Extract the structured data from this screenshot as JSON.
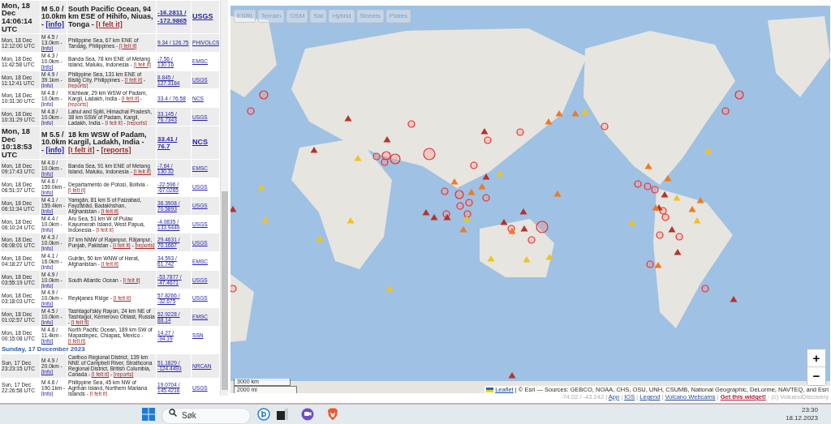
{
  "quake_list": {
    "link_separator": "-",
    "rows": [
      {
        "kind": "major",
        "time": "Mon, 18 Dec 14:06:14 UTC",
        "magnitude": "M 5.0 / 10.0km -",
        "info": "[info]",
        "location": "South Pacific Ocean, 94 km ESE of Hihifo, Niuas, Tonga -",
        "felt": "[I felt it]",
        "coords": "-16.2811 / -172.9865",
        "source": "USGS"
      },
      {
        "kind": "minor",
        "time": "Mon, 18 Dec 12:12:00 UTC",
        "magnitude": "M 4.5 / 13.0km -",
        "info": "[info]",
        "location": "Philippine Sea, 67 km ENE of Tandag, Philippines -",
        "felt": "[I felt it]",
        "coords": "9.34 / 126.75",
        "source": "PHIVOLCS"
      },
      {
        "kind": "minor",
        "time": "Mon, 18 Dec 11:42:58 UTC",
        "magnitude": "M 4.3 / 10.0km -",
        "info": "[info]",
        "location": "Banda Sea, 78 km ENE of Metang Island, Maluku, Indonesia -",
        "felt": "[I felt it]",
        "coords": "-7.56 / 130.16",
        "source": "EMSC"
      },
      {
        "kind": "minor",
        "time": "Mon, 18 Dec 11:12:41 UTC",
        "magnitude": "M 4.9 / 39.1km -",
        "info": "[info]",
        "location": "Philippine Sea, 131 km ENE of Bislig City, Philippines -",
        "felt": "[I felt it]",
        "reports": "[reports]",
        "coords": "8.845 / 127.3184",
        "source": "USGS"
      },
      {
        "kind": "minor",
        "time": "Mon, 18 Dec 10:31:30 UTC",
        "magnitude": "M 4.8 / 10.0km -",
        "info": "[info]",
        "location": "Kishtwar, 29 km WSW of Padam, Kargil, Ladakh, India -",
        "felt": "[I felt it]",
        "reports": "[reports]",
        "coords": "33.4 / 76.58",
        "source": "NCS"
      },
      {
        "kind": "minor",
        "time": "Mon, 18 Dec 10:31:29 UTC",
        "magnitude": "M 4.8 / 10.0km -",
        "info": "[info]",
        "location": "Lahul and Spiti, Himachal Pradesh, 38 km SSW of Padam, Kargil, Ladakh, India -",
        "felt": "[I felt it]",
        "reports": "[reports]",
        "coords": "33.145 / 76.7343",
        "source": "USGS"
      },
      {
        "kind": "major",
        "time": "Mon, 18 Dec 10:18:53 UTC",
        "magnitude": "M 5.5 / 10.0km -",
        "info": "[info]",
        "location": "18 km WSW of Padam, Kargil, Ladakh, India -",
        "felt": "[I felt it]",
        "reports": "[reports]",
        "coords": "33.41 / 76.7",
        "source": "NCS"
      },
      {
        "kind": "minor",
        "time": "Mon, 18 Dec 09:17:43 UTC",
        "magnitude": "M 4.0 / 10.0km -",
        "info": "[info]",
        "location": "Banda Sea, 91 km ENE of Metang Island, Maluku, Indonesia -",
        "felt": "[I felt it]",
        "coords": "-7.64 / 130.32",
        "source": "EMSC"
      },
      {
        "kind": "minor",
        "time": "Mon, 18 Dec 06:51:37 UTC",
        "magnitude": "M 4.6 / 159.0km -",
        "info": "[info]",
        "location": "Departamento de Potosí, Bolivia -",
        "felt": "[I felt it]",
        "coords": "-22.596 / -67.0265",
        "source": "USGS"
      },
      {
        "kind": "minor",
        "time": "Mon, 18 Dec 06:11:34 UTC",
        "magnitude": "M 4.1 / 159.4km -",
        "info": "[info]",
        "location": "Yamgān, 81 km S of Faizabad, Fayzābād, Badakhshan, Afghanistan -",
        "felt": "[I felt it]",
        "coords": "36.3908 / 70.5893",
        "source": "USGS"
      },
      {
        "kind": "minor",
        "time": "Mon, 18 Dec 06:10:24 UTC",
        "magnitude": "M 4.4 / 10.0km -",
        "info": "[info]",
        "location": "Aru Sea, 51 km W of Pulau Kayumerah Island, West Papua, Indonesia -",
        "felt": "[I felt it]",
        "coords": "-4.0835 / 133.9449",
        "source": "USGS"
      },
      {
        "kind": "minor",
        "time": "Mon, 18 Dec 06:08:01 UTC",
        "magnitude": "M 4.3 / 10.0km -",
        "info": "[info]",
        "location": "37 km NNW of Rajanpur, Rājanpur, Punjab, Pakistan -",
        "felt": "[I felt it]",
        "reports": "[reports]",
        "coords": "29.4631 / 70.1667",
        "source": "USGS"
      },
      {
        "kind": "minor",
        "time": "Mon, 18 Dec 04:18:27 UTC",
        "magnitude": "M 4.1 / 16.0km -",
        "info": "[info]",
        "location": "Gulrān, 50 km WNW of Herat, Afghanistan -",
        "felt": "[I felt it]",
        "coords": "34.593 / 61.742",
        "source": "EMSC"
      },
      {
        "kind": "minor",
        "time": "Mon, 18 Dec 03:55:19 UTC",
        "magnitude": "M 4.9 / 10.0km -",
        "info": "[info]",
        "location": "South Atlantic Ocean -",
        "felt": "[I felt it]",
        "coords": "-53.7877 / -47.4671",
        "source": "USGS"
      },
      {
        "kind": "minor",
        "time": "Mon, 18 Dec 03:18:03 UTC",
        "magnitude": "M 4.9 / 10.0km -",
        "info": "[info]",
        "location": "Reykjanes Ridge -",
        "felt": "[I felt it]",
        "coords": "57.8266 / -32.675",
        "source": "USGS"
      },
      {
        "kind": "minor",
        "time": "Mon, 18 Dec 01:02:57 UTC",
        "magnitude": "M 4.5 / 10.0km -",
        "info": "[info]",
        "location": "Tashtagol'skiy Rayon, 24 km NE of Tashtagol, Kemerovo Oblast, Russia -",
        "felt": "[I felt it]",
        "coords": "52.9228 / 88.14",
        "source": "EMSC"
      },
      {
        "kind": "minor",
        "time": "Mon, 18 Dec 00:15:08 UTC",
        "magnitude": "M 4.6 / 11.4km -",
        "info": "[info]",
        "location": "North Pacific Ocean, 189 km SW of Mapastepec, Chiapas, Mexico -",
        "felt": "[I felt it]",
        "coords": "14.27 / -94.19",
        "source": "SSN"
      },
      {
        "kind": "day_header",
        "title": "Sunday, 17 December 2023"
      },
      {
        "kind": "minor",
        "time": "Sun, 17 Dec 23:23:15 UTC",
        "magnitude": "M 4.9 / 20.0km -",
        "info": "[info]",
        "location": "Cariboo Regional District, 139 km NNE of Campbell River, Strathcona Regional District, British Columbia, Canada -",
        "felt": "[I felt it]",
        "reports": "[reports]",
        "coords": "51.1829 / -124.4493",
        "source": "NRCAN"
      },
      {
        "kind": "minor",
        "time": "Sun, 17 Dec 22:26:58 UTC",
        "magnitude": "M 4.6 / 190.1km -",
        "info": "[info]",
        "location": "Philippine Sea, 45 km NW of Agrihan Island, Northern Mariana Islands -",
        "felt": "[I felt it]",
        "coords": "19.0704 / 145.4216",
        "source": "USGS"
      }
    ]
  },
  "map": {
    "layers": [
      {
        "label": "ESRI"
      },
      {
        "label": "Terrain"
      },
      {
        "label": "OSM"
      },
      {
        "label": "Sat"
      },
      {
        "label": "Hybrid"
      },
      {
        "label": "Streets"
      },
      {
        "label": "Plates"
      }
    ],
    "zoom_in": "+",
    "zoom_out": "−",
    "scale": [
      "3000 km",
      "2000 mi"
    ]
  },
  "attribution": {
    "line1": [
      {
        "kind": "link",
        "text": "Leaflet"
      },
      {
        "kind": "text",
        "text": "| © Esri — Sources: GEBCO, NOAA, CHS, OSU, UNH, CSUMB, National Geographic, DeLorme, NAVTEQ, and Esri"
      }
    ],
    "line2": [
      {
        "kind": "muted",
        "text": "-74.02 / -43.242 |"
      },
      {
        "kind": "link",
        "text": "App"
      },
      {
        "kind": "muted",
        "text": "|"
      },
      {
        "kind": "link",
        "text": "IOS"
      },
      {
        "kind": "muted",
        "text": "|"
      },
      {
        "kind": "link",
        "text": "Legend"
      },
      {
        "kind": "muted",
        "text": "|"
      },
      {
        "kind": "link",
        "text": "Volcano Webcams"
      },
      {
        "kind": "muted",
        "text": "|"
      },
      {
        "kind": "highlight",
        "text": "Get this widget!"
      },
      {
        "kind": "muted",
        "text": "· (c) VolcanoDiscovery"
      }
    ]
  },
  "taskbar": {
    "search": {
      "placeholder": "Søk"
    },
    "time": "23:30",
    "date": "18.12.2023"
  }
}
